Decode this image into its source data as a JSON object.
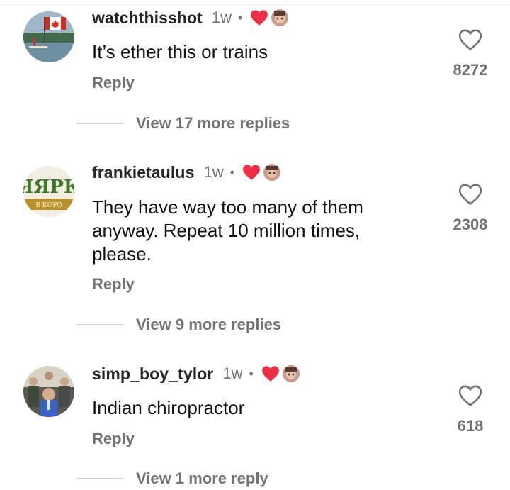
{
  "comments": [
    {
      "username": "watchthisshot",
      "time": "1w",
      "dot": "•",
      "text": "It’s ether this or trains",
      "reply_label": "Reply",
      "likes": "8272",
      "view_more": "View 17 more replies"
    },
    {
      "username": "frankietaulus",
      "time": "1w",
      "dot": "•",
      "text": "They have way too many of them anyway. Repeat 10 million times, please.",
      "reply_label": "Reply",
      "likes": "2308",
      "view_more": "View 9 more replies",
      "avatar_text": "ЯЯРК",
      "avatar_subtext": "В КОРО"
    },
    {
      "username": "simp_boy_tylor",
      "time": "1w",
      "dot": "•",
      "text": "Indian chiropractor",
      "reply_label": "Reply",
      "likes": "618",
      "view_more": "View 1 more reply"
    }
  ],
  "colors": {
    "heart_red": "#ed2f45",
    "muted_text": "#737373",
    "username": "#262626"
  },
  "icons": {
    "liked_heart": "creator-liked-heart-icon",
    "like": "like-heart-outline-icon"
  }
}
